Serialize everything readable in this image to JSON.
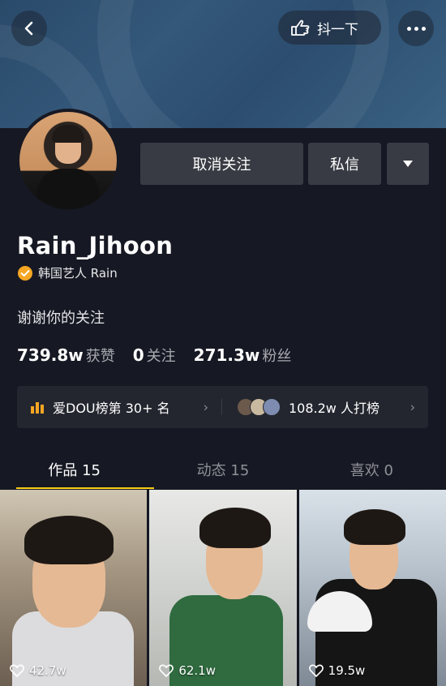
{
  "header": {
    "shake_label": "抖一下"
  },
  "profile": {
    "username": "Rain_Jihoon",
    "verified_label": "韩国艺人 Rain",
    "bio": "谢谢你的关注",
    "unfollow_label": "取消关注",
    "message_label": "私信"
  },
  "stats": [
    {
      "value": "739.8w",
      "label": "获赞"
    },
    {
      "value": "0",
      "label": "关注"
    },
    {
      "value": "271.3w",
      "label": "粉丝"
    }
  ],
  "rank": {
    "left_text": "爱DOU榜第 30+ 名",
    "right_text": "108.2w 人打榜"
  },
  "tabs": [
    {
      "label": "作品 15"
    },
    {
      "label": "动态 15"
    },
    {
      "label": "喜欢 0"
    }
  ],
  "videos": [
    {
      "likes": "42.7w"
    },
    {
      "likes": "62.1w"
    },
    {
      "likes": "19.5w"
    }
  ],
  "colors": {
    "background": "#161823",
    "button": "#393b44",
    "accent": "#face15",
    "verified": "#f5a623"
  }
}
